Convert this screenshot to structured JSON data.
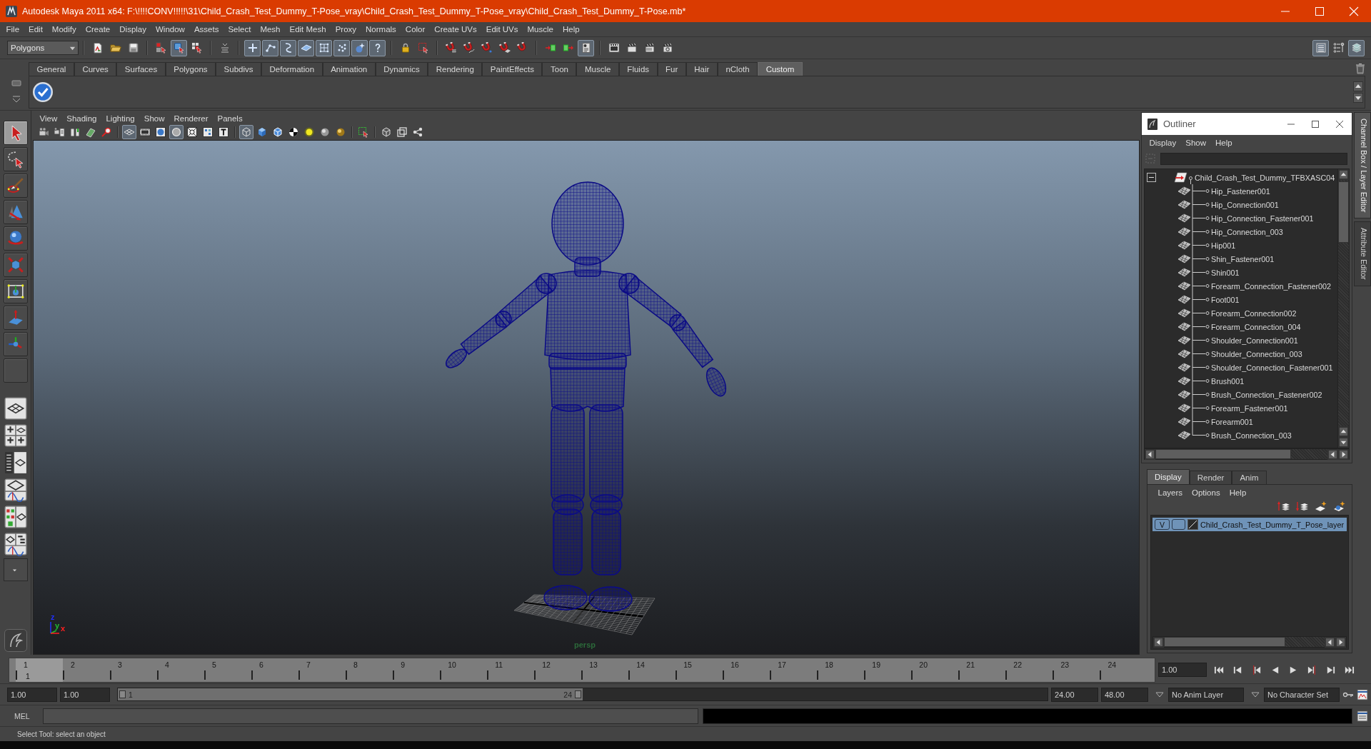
{
  "window": {
    "title": "Autodesk Maya 2011 x64: F:\\!!!!CONV!!!!!\\31\\Child_Crash_Test_Dummy_T-Pose_vray\\Child_Crash_Test_Dummy_T-Pose_vray\\Child_Crash_Test_Dummy_T-Pose.mb*"
  },
  "menu_bar": [
    "File",
    "Edit",
    "Modify",
    "Create",
    "Display",
    "Window",
    "Assets",
    "Select",
    "Mesh",
    "Edit Mesh",
    "Proxy",
    "Normals",
    "Color",
    "Create UVs",
    "Edit UVs",
    "Muscle",
    "Help"
  ],
  "status_line": {
    "menu_set": "Polygons",
    "groups": [
      [
        {
          "kind": "new-scene",
          "on": false
        },
        {
          "kind": "open-scene",
          "on": false
        },
        {
          "kind": "save-scene",
          "on": false
        }
      ],
      [
        {
          "kind": "hierarchy-mode",
          "on": false
        },
        {
          "kind": "object-mode",
          "on": true
        },
        {
          "kind": "component-mode",
          "on": false
        }
      ],
      [
        {
          "kind": "mask-menu",
          "on": false
        }
      ],
      [
        {
          "kind": "mask-handles",
          "on": true
        },
        {
          "kind": "mask-joints",
          "on": true
        },
        {
          "kind": "mask-curves",
          "on": true
        },
        {
          "kind": "mask-surfaces",
          "on": true
        },
        {
          "kind": "mask-deformers",
          "on": true
        },
        {
          "kind": "mask-dynamics",
          "on": true
        },
        {
          "kind": "mask-rendering",
          "on": true
        },
        {
          "kind": "mask-misc",
          "on": true
        }
      ],
      [
        {
          "kind": "lock-selection",
          "on": false
        },
        {
          "kind": "highlight-selection",
          "on": false
        }
      ],
      [
        {
          "kind": "snap-grid",
          "on": false
        },
        {
          "kind": "snap-curve",
          "on": false
        },
        {
          "kind": "snap-point",
          "on": false
        },
        {
          "kind": "snap-view-plane",
          "on": false
        },
        {
          "kind": "make-live",
          "on": false
        }
      ],
      [
        {
          "kind": "input-ops",
          "on": false
        },
        {
          "kind": "output-ops",
          "on": false
        },
        {
          "kind": "history",
          "on": true
        }
      ],
      [
        {
          "kind": "render-view",
          "on": false
        },
        {
          "kind": "render-frame",
          "on": false
        },
        {
          "kind": "ipr-render",
          "on": false
        },
        {
          "kind": "render-settings",
          "on": false
        }
      ]
    ],
    "panel_toggles": [
      {
        "kind": "channel-box",
        "on": true
      },
      {
        "kind": "tool-settings",
        "on": false
      },
      {
        "kind": "layer-editor",
        "on": true
      }
    ]
  },
  "shelf": {
    "tabs": [
      {
        "label": "General",
        "selected": false
      },
      {
        "label": "Curves",
        "selected": false
      },
      {
        "label": "Surfaces",
        "selected": false
      },
      {
        "label": "Polygons",
        "selected": false
      },
      {
        "label": "Subdivs",
        "selected": false
      },
      {
        "label": "Deformation",
        "selected": false
      },
      {
        "label": "Animation",
        "selected": false
      },
      {
        "label": "Dynamics",
        "selected": false
      },
      {
        "label": "Rendering",
        "selected": false
      },
      {
        "label": "PaintEffects",
        "selected": false
      },
      {
        "label": "Toon",
        "selected": false
      },
      {
        "label": "Muscle",
        "selected": false
      },
      {
        "label": "Fluids",
        "selected": false
      },
      {
        "label": "Fur",
        "selected": false
      },
      {
        "label": "Hair",
        "selected": false
      },
      {
        "label": "nCloth",
        "selected": false
      },
      {
        "label": "Custom",
        "selected": true
      }
    ]
  },
  "toolbox": {
    "tools": [
      {
        "kind": "select",
        "selected": true
      },
      {
        "kind": "lasso",
        "selected": false
      },
      {
        "kind": "paint-select",
        "selected": false
      },
      {
        "kind": "move",
        "selected": false
      },
      {
        "kind": "rotate",
        "selected": false
      },
      {
        "kind": "scale",
        "selected": false
      },
      {
        "kind": "universal",
        "selected": false
      },
      {
        "kind": "soft-mod",
        "selected": false
      },
      {
        "kind": "show-manip",
        "selected": false
      },
      {
        "kind": "last-tool",
        "selected": false
      }
    ],
    "layouts": [
      {
        "kind": "single-perspective"
      },
      {
        "kind": "four-view"
      },
      {
        "kind": "outliner-persp"
      },
      {
        "kind": "persp-graph"
      },
      {
        "kind": "hypershade-persp"
      },
      {
        "kind": "persp-outliner-graph"
      }
    ]
  },
  "viewport": {
    "menu": [
      "View",
      "Shading",
      "Lighting",
      "Show",
      "Renderer",
      "Panels"
    ],
    "toolbar": [
      [
        {
          "kind": "camera",
          "on": false
        },
        {
          "kind": "camera-attributes",
          "on": false
        },
        {
          "kind": "bookmark",
          "on": false
        },
        {
          "kind": "image-plane",
          "on": false
        },
        {
          "kind": "pan-zoom",
          "on": false
        }
      ],
      [
        {
          "kind": "grid",
          "on": true
        },
        {
          "kind": "film-gate",
          "on": false
        },
        {
          "kind": "resolution-gate",
          "on": false
        },
        {
          "kind": "gate-mask",
          "on": true
        },
        {
          "kind": "field-chart",
          "on": false
        },
        {
          "kind": "safe-action",
          "on": false
        },
        {
          "kind": "safe-title",
          "on": false
        }
      ],
      [
        {
          "kind": "wireframe",
          "on": true
        },
        {
          "kind": "smooth-shade",
          "on": false
        },
        {
          "kind": "wire-on-shaded",
          "on": false
        },
        {
          "kind": "textured",
          "on": false
        },
        {
          "kind": "default-light",
          "on": false
        },
        {
          "kind": "shadows",
          "on": false
        },
        {
          "kind": "high-quality",
          "on": false
        }
      ],
      [
        {
          "kind": "isolate",
          "on": false
        }
      ],
      [
        {
          "kind": "xray",
          "on": false
        },
        {
          "kind": "xray-joints",
          "on": false
        },
        {
          "kind": "node-editor",
          "on": false
        }
      ]
    ],
    "camera_label": "persp",
    "axis_labels": [
      {
        "label": "z",
        "color": "#2030ff"
      },
      {
        "label": "y",
        "color": "#20c030"
      },
      {
        "label": "x",
        "color": "#ff2020"
      }
    ]
  },
  "outliner": {
    "title": "Outliner",
    "menu": [
      "Display",
      "Show",
      "Help"
    ],
    "tree": [
      {
        "label": "Child_Crash_Test_Dummy_TFBXASC04",
        "expanded": true,
        "children": [
          {
            "label": "Hip_Fastener001"
          },
          {
            "label": "Hip_Connection001"
          },
          {
            "label": "Hip_Connection_Fastener001"
          },
          {
            "label": "Hip_Connection_003"
          },
          {
            "label": "Hip001"
          },
          {
            "label": "Shin_Fastener001"
          },
          {
            "label": "Shin001"
          },
          {
            "label": "Forearm_Connection_Fastener002"
          },
          {
            "label": "Foot001"
          },
          {
            "label": "Forearm_Connection002"
          },
          {
            "label": "Forearm_Connection_004"
          },
          {
            "label": "Shoulder_Connection001"
          },
          {
            "label": "Shoulder_Connection_003"
          },
          {
            "label": "Shoulder_Connection_Fastener001"
          },
          {
            "label": "Brush001"
          },
          {
            "label": "Brush_Connection_Fastener002"
          },
          {
            "label": "Forearm_Fastener001"
          },
          {
            "label": "Forearm001"
          },
          {
            "label": "Brush_Connection_003"
          }
        ]
      }
    ]
  },
  "side_tabs": [
    {
      "label": "Channel Box / Layer Editor",
      "selected": true
    },
    {
      "label": "Attribute Editor",
      "selected": false
    }
  ],
  "layer_editor": {
    "tabs": [
      {
        "label": "Display",
        "selected": true
      },
      {
        "label": "Render",
        "selected": false
      },
      {
        "label": "Anim",
        "selected": false
      }
    ],
    "menu": [
      "Layers",
      "Options",
      "Help"
    ],
    "layers": [
      {
        "visibility": "V",
        "name": "Child_Crash_Test_Dummy_T_Pose_layer",
        "selected": true
      }
    ]
  },
  "time_slider": {
    "frames": [
      {
        "label": "1",
        "selected": true
      },
      {
        "label": "2",
        "selected": false
      },
      {
        "label": "3",
        "selected": false
      },
      {
        "label": "4",
        "selected": false
      },
      {
        "label": "5",
        "selected": false
      },
      {
        "label": "6",
        "selected": false
      },
      {
        "label": "7",
        "selected": false
      },
      {
        "label": "8",
        "selected": false
      },
      {
        "label": "9",
        "selected": false
      },
      {
        "label": "10",
        "selected": false
      },
      {
        "label": "11",
        "selected": false
      },
      {
        "label": "12",
        "selected": false
      },
      {
        "label": "13",
        "selected": false
      },
      {
        "label": "14",
        "selected": false
      },
      {
        "label": "15",
        "selected": false
      },
      {
        "label": "16",
        "selected": false
      },
      {
        "label": "17",
        "selected": false
      },
      {
        "label": "18",
        "selected": false
      },
      {
        "label": "19",
        "selected": false
      },
      {
        "label": "20",
        "selected": false
      },
      {
        "label": "21",
        "selected": false
      },
      {
        "label": "22",
        "selected": false
      },
      {
        "label": "23",
        "selected": false
      },
      {
        "label": "24",
        "selected": false
      }
    ],
    "current_frame": "1",
    "current_time": "1.00"
  },
  "range_slider": {
    "start_time": "1.00",
    "playback_start": "1.00",
    "range_start": "1",
    "range_end": "24",
    "level": 0.5,
    "playback_end": "24.00",
    "end_time": "48.00",
    "anim_layer": "No Anim Layer",
    "character_set": "No Character Set"
  },
  "command_line": {
    "language": "MEL"
  },
  "help_line": "Select Tool: select an object"
}
